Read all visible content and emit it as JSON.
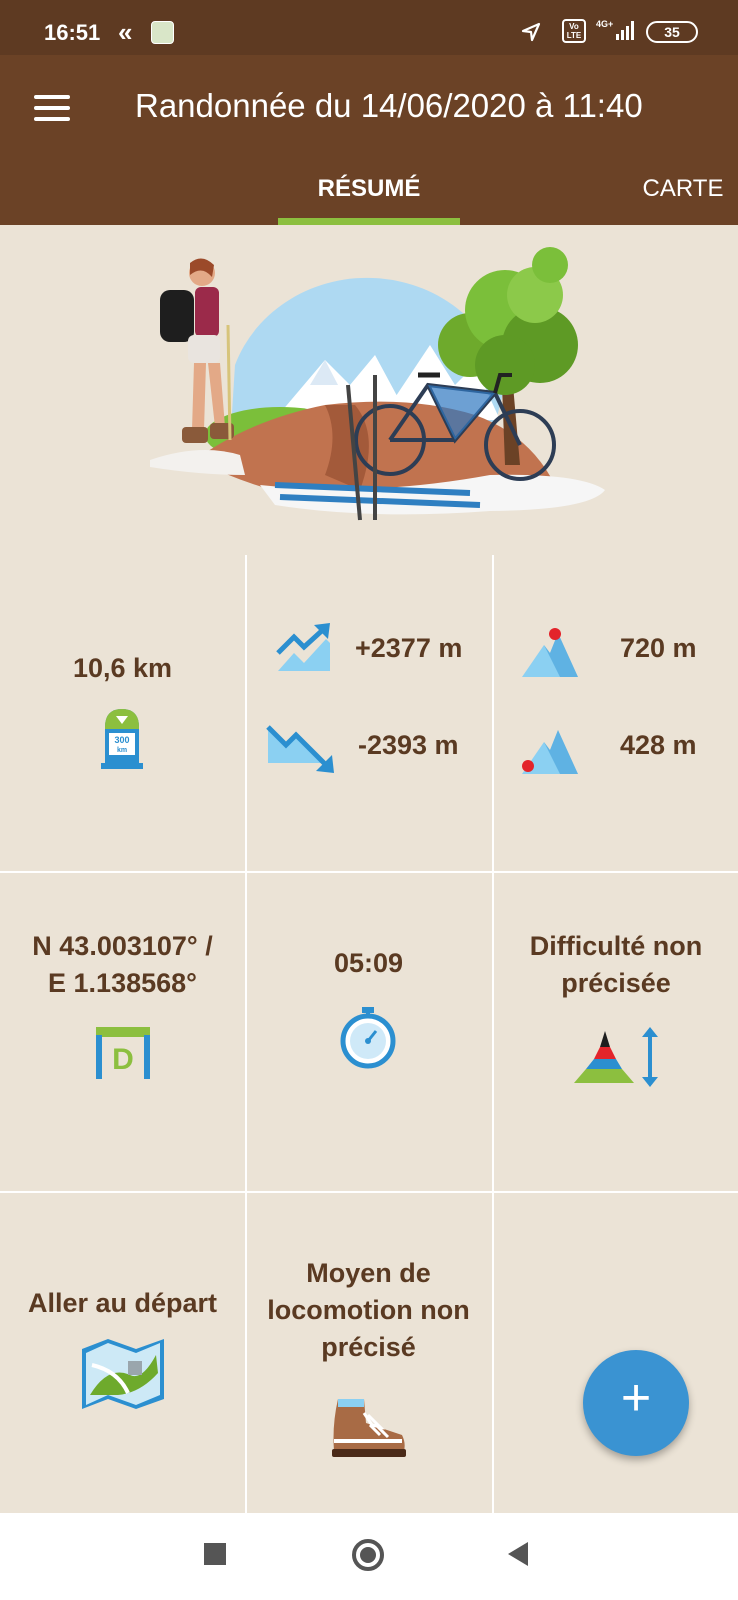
{
  "status_bar": {
    "time": "16:51",
    "chevron": "«",
    "network": "4G+",
    "volte": "Vo LTE",
    "battery": "35",
    "icons": [
      "app-icon",
      "location-icon",
      "volte-icon",
      "signal-icon",
      "battery-icon"
    ]
  },
  "app_bar": {
    "title": "Randonnée du 14/06/2020 à 11:40",
    "menu_icon": "hamburger-menu-icon"
  },
  "tabs": [
    {
      "label": "RÉSUMÉ",
      "active": true
    },
    {
      "label": "CARTE",
      "active": false
    }
  ],
  "colors": {
    "status_bar": "#5e3a22",
    "app_bar": "#6b4226",
    "background": "#ebe3d6",
    "accent": "#8cbf3f",
    "text": "#5a3a22",
    "fab": "#3a93d2",
    "icon_blue": "#2b8fd0"
  },
  "stats": {
    "distance": {
      "value": "10,6 km",
      "icon": "distance-marker-icon",
      "marker_label_top": "300",
      "marker_label_bottom": "km"
    },
    "elevation_gain": {
      "value": "+2377 m",
      "icon": "trend-up-icon"
    },
    "elevation_loss": {
      "value": "-2393 m",
      "icon": "trend-down-icon"
    },
    "max_altitude": {
      "value": "720 m",
      "icon": "mountain-summit-icon"
    },
    "min_altitude": {
      "value": "428 m",
      "icon": "mountain-base-icon"
    },
    "start_coords": {
      "line1": "N 43.003107° /",
      "line2": "E 1.138568°",
      "icon": "departure-flag-icon",
      "icon_letter": "D"
    },
    "duration": {
      "value": "05:09",
      "icon": "stopwatch-icon"
    },
    "difficulty": {
      "line1": "Difficulté non",
      "line2": "précisée",
      "icon": "difficulty-mountain-icon"
    },
    "go_to_start": {
      "value": "Aller au départ",
      "icon": "map-icon"
    },
    "locomotion": {
      "line1": "Moyen de",
      "line2": "locomotion non",
      "line3": "précisé",
      "icon": "hiking-boot-icon"
    }
  },
  "fab": {
    "label": "+",
    "icon": "add-icon"
  },
  "nav_bar": {
    "icons": [
      "recent-apps-icon",
      "home-icon",
      "back-icon"
    ]
  }
}
